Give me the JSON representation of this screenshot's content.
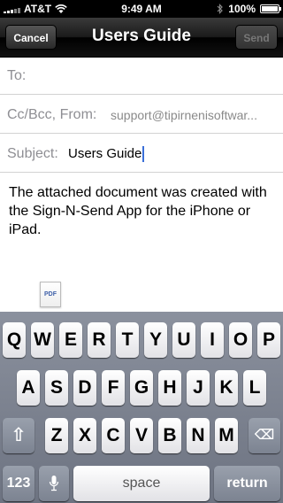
{
  "status": {
    "carrier": "AT&T",
    "time": "9:49 AM",
    "battery": "100%",
    "battery_level": 1.0
  },
  "nav": {
    "cancel_label": "Cancel",
    "title": "Users Guide",
    "send_label": "Send"
  },
  "fields": {
    "to_label": "To:",
    "cc_label": "Cc/Bcc, From:",
    "cc_value": "support@tipirnenisoftwar...",
    "subject_label": "Subject:",
    "subject_value": "Users Guide"
  },
  "body": {
    "text": "The attached document was created with the Sign-N-Send App for the iPhone or iPad."
  },
  "attachment": {
    "label": "PDF"
  },
  "keyboard": {
    "row1": [
      "Q",
      "W",
      "E",
      "R",
      "T",
      "Y",
      "U",
      "I",
      "O",
      "P"
    ],
    "row2": [
      "A",
      "S",
      "D",
      "F",
      "G",
      "H",
      "J",
      "K",
      "L"
    ],
    "row3": [
      "Z",
      "X",
      "C",
      "V",
      "B",
      "N",
      "M"
    ],
    "shift_glyph": "⇧",
    "delete_glyph": "⌫",
    "numbers_label": "123",
    "mic_glyph": "🎤",
    "space_label": "space",
    "return_label": "return"
  }
}
